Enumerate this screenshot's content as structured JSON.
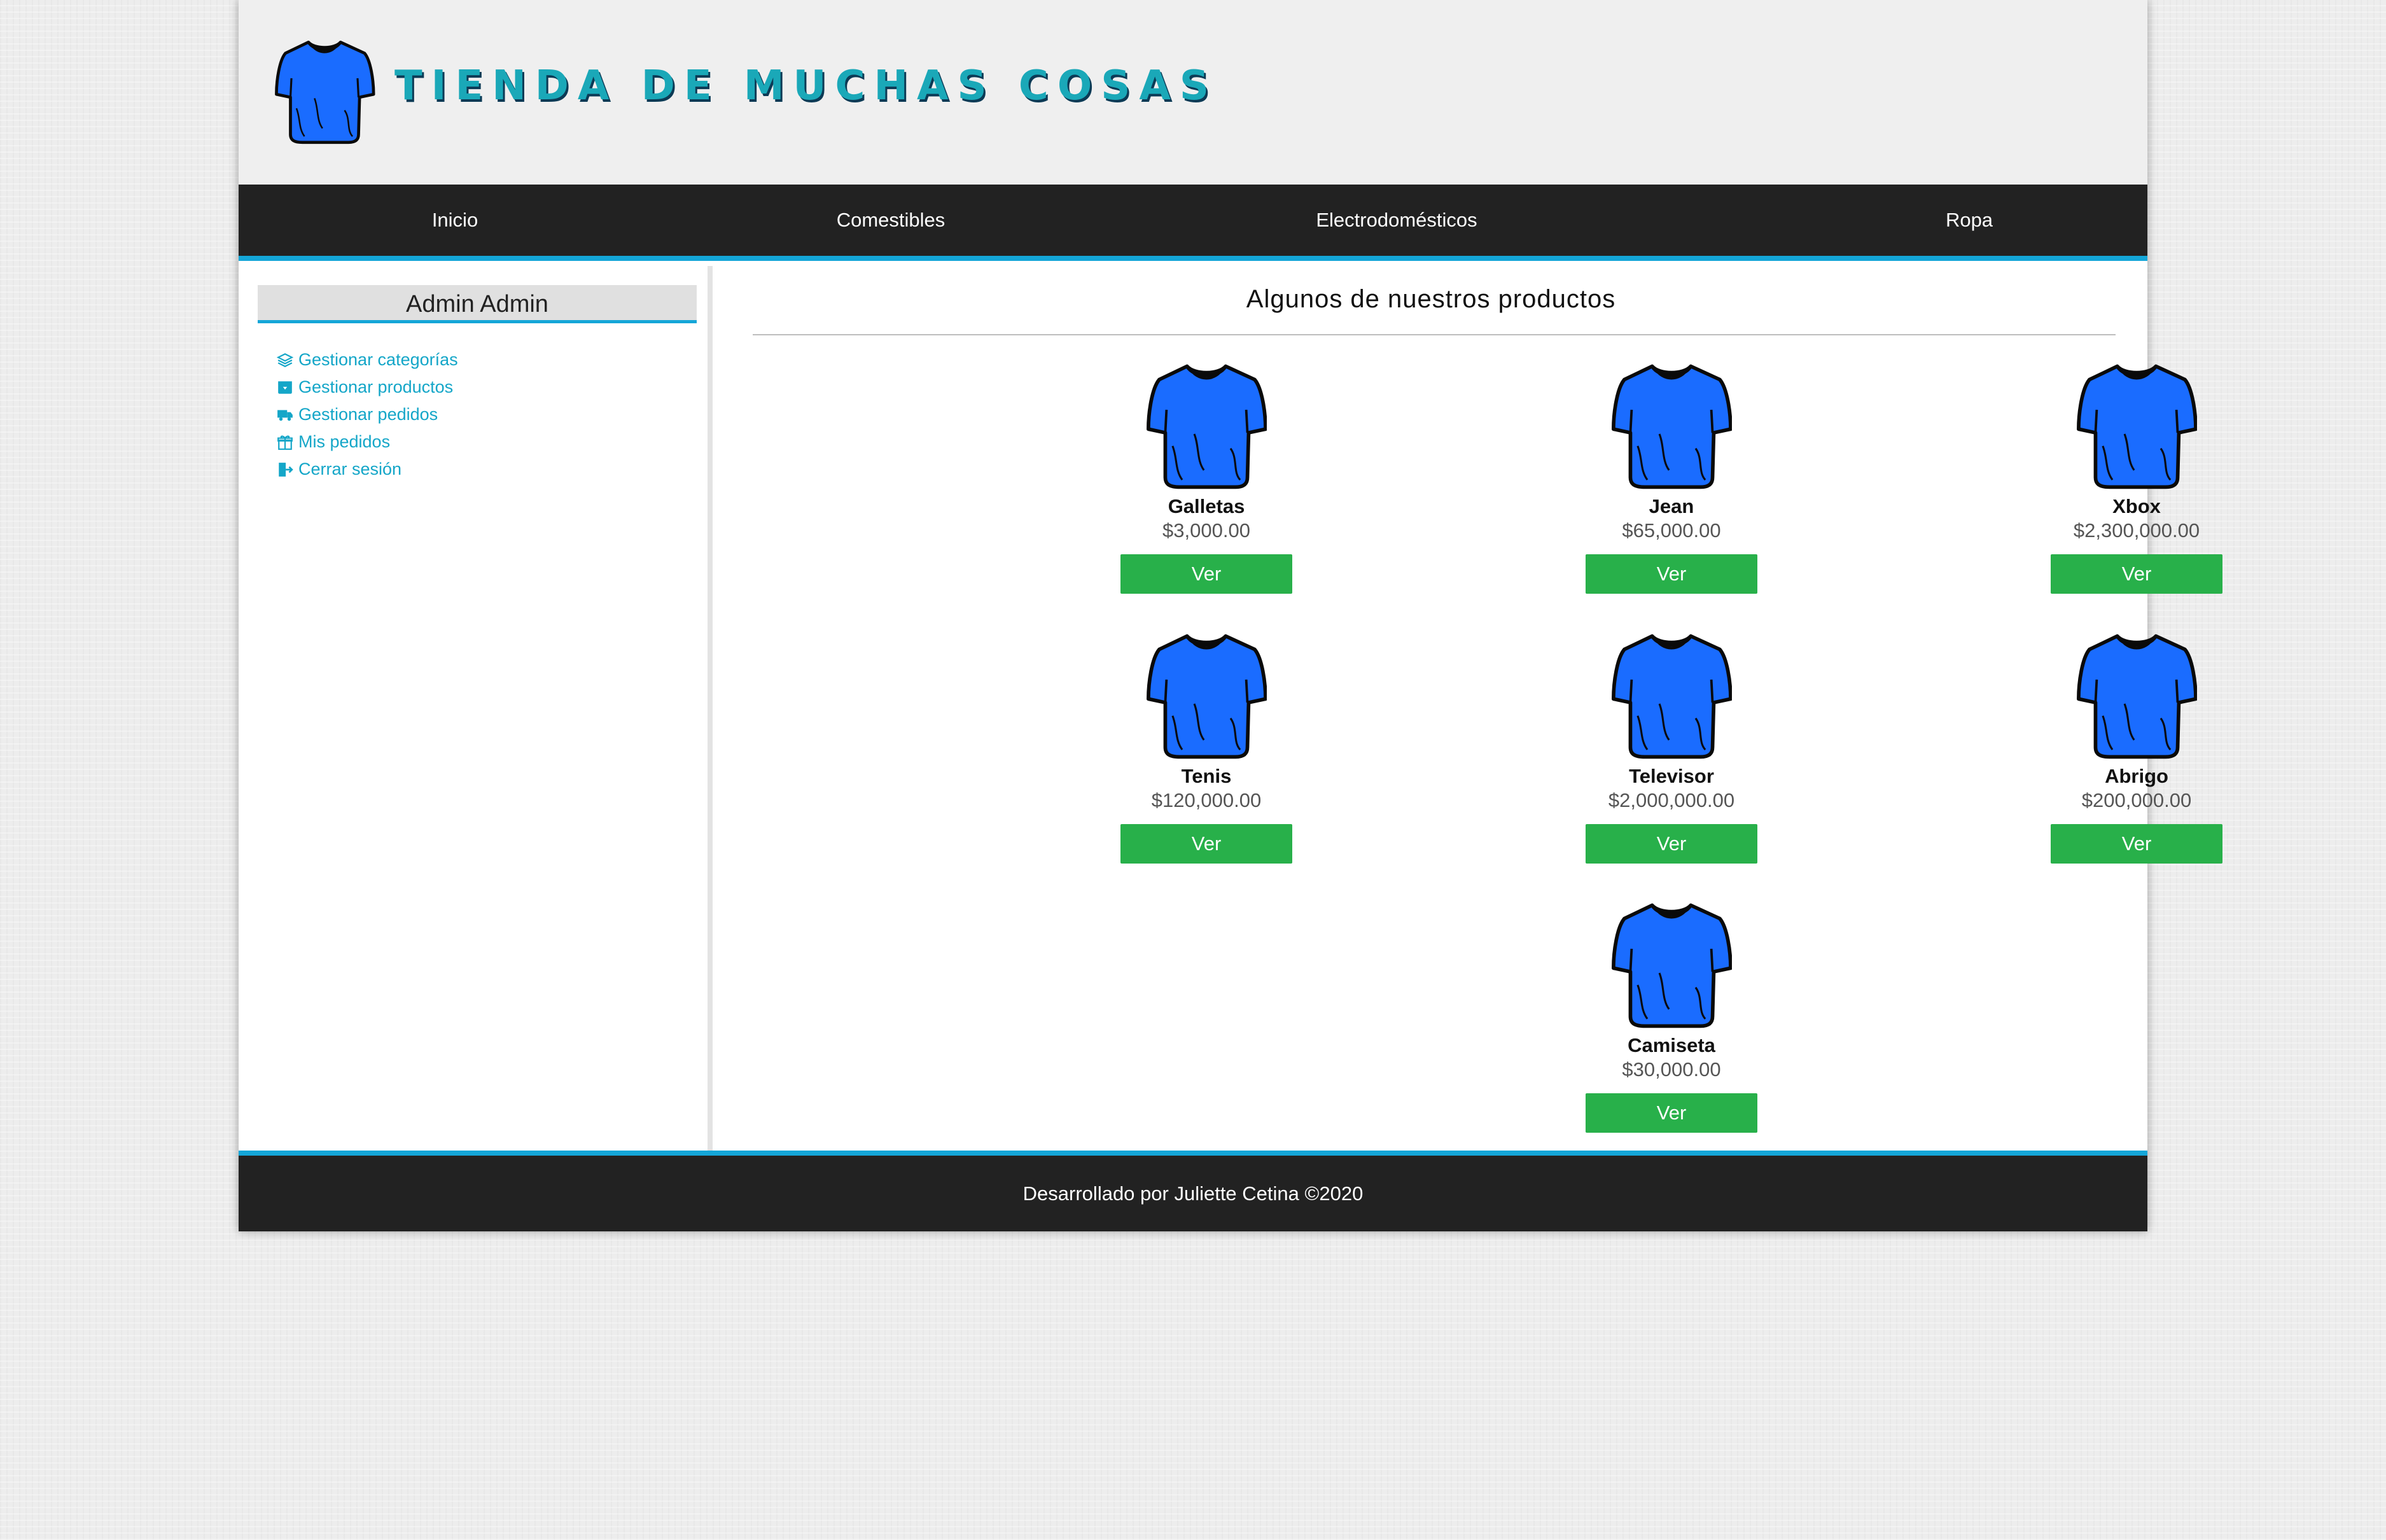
{
  "header": {
    "site_title": "TIENDA DE MUCHAS COSAS",
    "logo_icon": "tshirt-icon"
  },
  "nav": {
    "items": [
      {
        "label": "Inicio"
      },
      {
        "label": "Comestibles"
      },
      {
        "label": "Electrodomésticos"
      },
      {
        "label": "Ropa"
      }
    ]
  },
  "sidebar": {
    "user_name": "Admin Admin",
    "menu": [
      {
        "label": "Gestionar categorías",
        "icon": "layers-icon"
      },
      {
        "label": "Gestionar productos",
        "icon": "box-icon"
      },
      {
        "label": "Gestionar pedidos",
        "icon": "truck-icon"
      },
      {
        "label": "Mis pedidos",
        "icon": "gift-icon"
      },
      {
        "label": "Cerrar sesión",
        "icon": "logout-icon"
      }
    ]
  },
  "main": {
    "title": "Algunos de nuestros productos",
    "button_label": "Ver",
    "products": [
      {
        "name": "Galletas",
        "price": "$3,000.00"
      },
      {
        "name": "Jean",
        "price": "$65,000.00"
      },
      {
        "name": "Xbox",
        "price": "$2,300,000.00"
      },
      {
        "name": "Tenis",
        "price": "$120,000.00"
      },
      {
        "name": "Televisor",
        "price": "$2,000,000.00"
      },
      {
        "name": "Abrigo",
        "price": "$200,000.00"
      },
      {
        "name": "Camiseta",
        "price": "$30,000.00"
      }
    ]
  },
  "footer": {
    "text": "Desarrollado por Juliette Cetina ©2020"
  },
  "colors": {
    "accent": "#14a6d8",
    "button": "#28b04a",
    "dark_bar": "#222222",
    "shirt": "#1a6cff"
  }
}
